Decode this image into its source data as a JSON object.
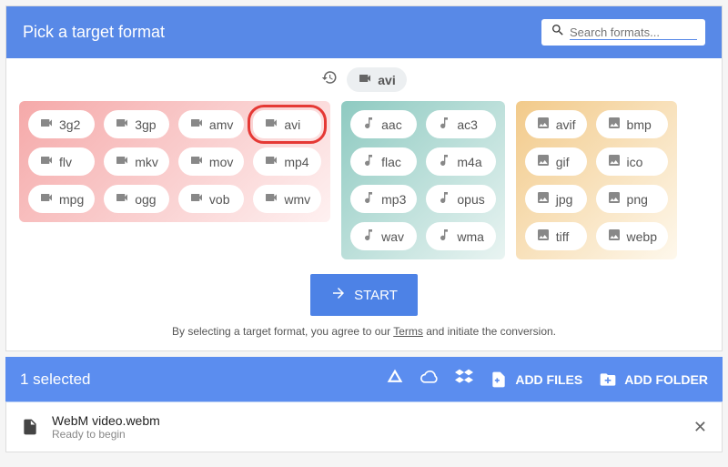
{
  "header": {
    "title": "Pick a target format",
    "search_placeholder": "Search formats..."
  },
  "history": {
    "recent": "avi"
  },
  "groups": {
    "video": [
      "3g2",
      "3gp",
      "amv",
      "avi",
      "flv",
      "mkv",
      "mov",
      "mp4",
      "mpg",
      "ogg",
      "vob",
      "wmv"
    ],
    "audio": [
      "aac",
      "ac3",
      "flac",
      "m4a",
      "mp3",
      "opus",
      "wav",
      "wma"
    ],
    "image": [
      "avif",
      "bmp",
      "gif",
      "ico",
      "jpg",
      "png",
      "tiff",
      "webp"
    ]
  },
  "highlighted": "avi",
  "start_label": "START",
  "disclaimer_pre": "By selecting a target format, you agree to our ",
  "disclaimer_link": "Terms",
  "disclaimer_post": " and initiate the conversion.",
  "toolbar": {
    "selected": "1 selected",
    "add_files": "ADD FILES",
    "add_folder": "ADD FOLDER"
  },
  "file": {
    "name": "WebM video.webm",
    "status": "Ready to begin"
  }
}
